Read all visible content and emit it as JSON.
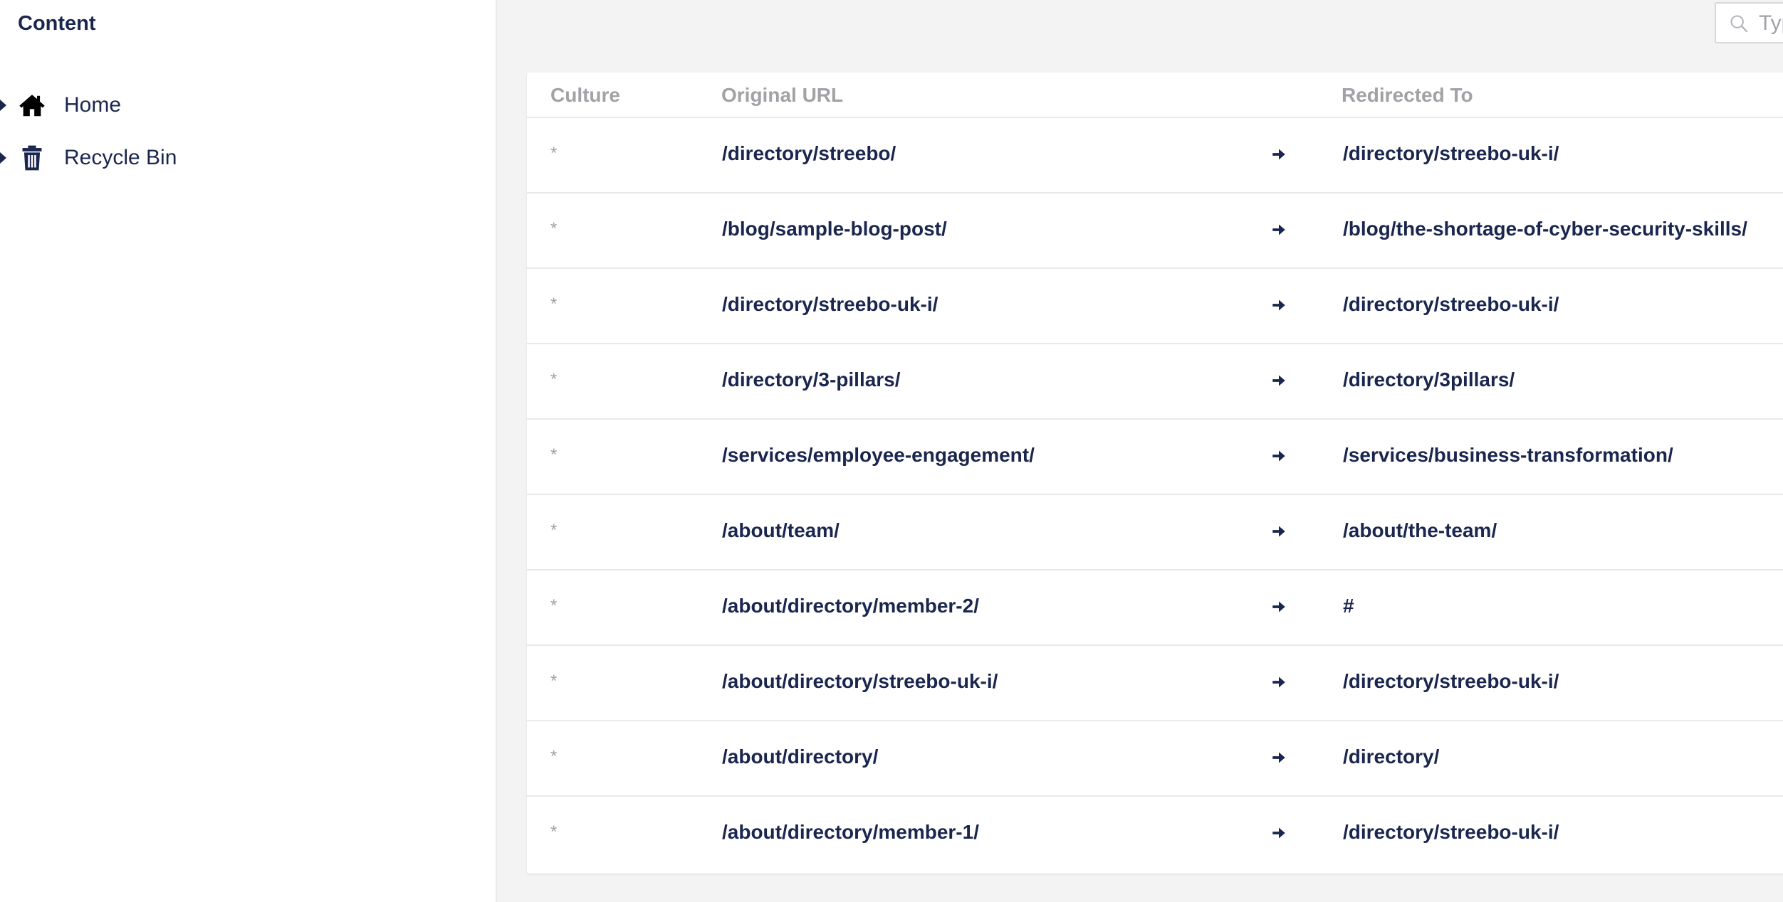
{
  "sidebar": {
    "title": "Content",
    "items": [
      {
        "label": "Home",
        "icon": "home-icon"
      },
      {
        "label": "Recycle Bin",
        "icon": "trash-icon"
      }
    ]
  },
  "search": {
    "placeholder": "Type to search..."
  },
  "table": {
    "headers": {
      "culture": "Culture",
      "original": "Original URL",
      "redirected": "Redirected To"
    },
    "rows": [
      {
        "culture": "*",
        "original": "/directory/streebo/",
        "redirect": "/directory/streebo-uk-i/"
      },
      {
        "culture": "*",
        "original": "/blog/sample-blog-post/",
        "redirect": "/blog/the-shortage-of-cyber-security-skills/"
      },
      {
        "culture": "*",
        "original": "/directory/streebo-uk-i/",
        "redirect": "/directory/streebo-uk-i/"
      },
      {
        "culture": "*",
        "original": "/directory/3-pillars/",
        "redirect": "/directory/3pillars/"
      },
      {
        "culture": "*",
        "original": "/services/employee-engagement/",
        "redirect": "/services/business-transformation/"
      },
      {
        "culture": "*",
        "original": "/about/team/",
        "redirect": "/about/the-team/"
      },
      {
        "culture": "*",
        "original": "/about/directory/member-2/",
        "redirect": "#"
      },
      {
        "culture": "*",
        "original": "/about/directory/streebo-uk-i/",
        "redirect": "/directory/streebo-uk-i/"
      },
      {
        "culture": "*",
        "original": "/about/directory/",
        "redirect": "/directory/"
      },
      {
        "culture": "*",
        "original": "/about/directory/member-1/",
        "redirect": "/directory/streebo-uk-i/"
      }
    ]
  },
  "colors": {
    "primary_text": "#1b264f",
    "muted_text": "#a2a1a6",
    "page_background": "#f4f3f3",
    "border": "#e9e9eb"
  }
}
